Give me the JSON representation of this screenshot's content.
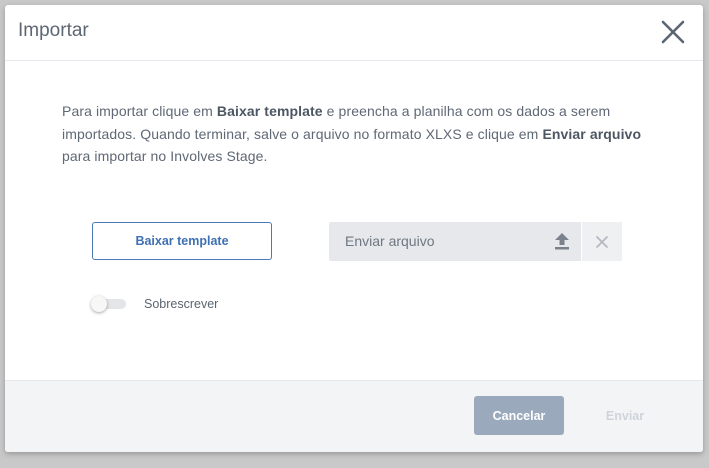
{
  "dialog": {
    "title": "Importar",
    "close_icon": "close-icon"
  },
  "instructions": {
    "part1": "Para importar clique em ",
    "bold1": "Baixar template",
    "part2": " e preencha a planilha com os dados a serem importados. Quando terminar, salve o arquivo no formato XLXS e clique em ",
    "bold2": "Enviar arquivo",
    "part3": " para importar no Involves Stage."
  },
  "actions": {
    "download_template_label": "Baixar template",
    "upload_label": "Enviar arquivo",
    "upload_icon": "upload-icon",
    "clear_icon": "close-icon"
  },
  "overwrite": {
    "label": "Sobrescrever",
    "checked": false
  },
  "footer": {
    "cancel_label": "Cancelar",
    "send_label": "Enviar",
    "send_enabled": false
  },
  "colors": {
    "accent": "#3f70b3",
    "cancel_bg": "#9aa9bb",
    "disabled_text": "#cfd4da"
  }
}
